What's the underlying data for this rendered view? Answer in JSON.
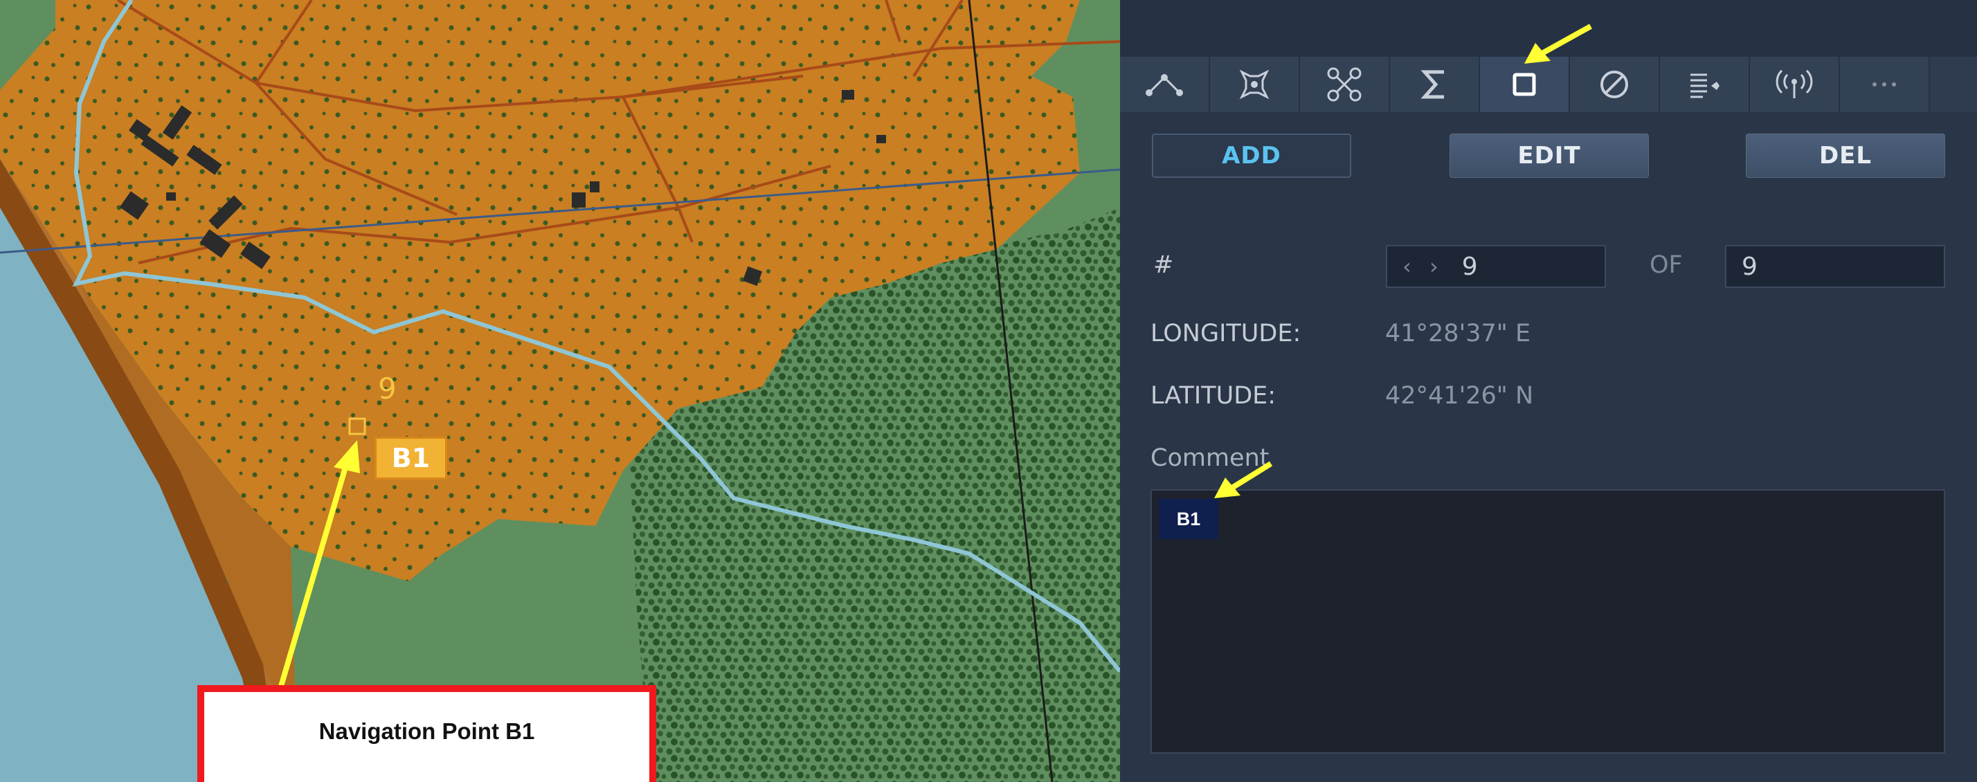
{
  "map": {
    "waypoint_number": "9",
    "waypoint_tag": "B1",
    "callout_text": "Navigation Point B1"
  },
  "panel": {
    "tabs": [
      {
        "icon": "route-icon"
      },
      {
        "icon": "target-point-icon"
      },
      {
        "icon": "drone-icon"
      },
      {
        "icon": "sigma-icon"
      },
      {
        "icon": "square-point-icon",
        "active": true
      },
      {
        "icon": "no-entry-icon"
      },
      {
        "icon": "list-settings-icon"
      },
      {
        "icon": "radio-antenna-icon"
      },
      {
        "icon": "more-icon"
      }
    ],
    "buttons": {
      "add": "ADD",
      "edit": "EDIT",
      "del": "DEL"
    },
    "number_label": "#",
    "number_value": "9",
    "of_label": "OF",
    "of_value": "9",
    "longitude_label": "LONGITUDE:",
    "longitude_value": "41°28'37\" E",
    "latitude_label": "LATITUDE:",
    "latitude_value": "42°41'26\" N",
    "comment_label": "Comment",
    "comment_value": "B1"
  },
  "colors": {
    "terrain_urban": "#c97f22",
    "terrain_grass": "#5f8f5f",
    "water": "#7fb2c2",
    "panel_bg": "#2a3647",
    "accent_add": "#5ac3f0",
    "annotation_arrow": "#ffff33",
    "callout_border": "#f0191e"
  }
}
